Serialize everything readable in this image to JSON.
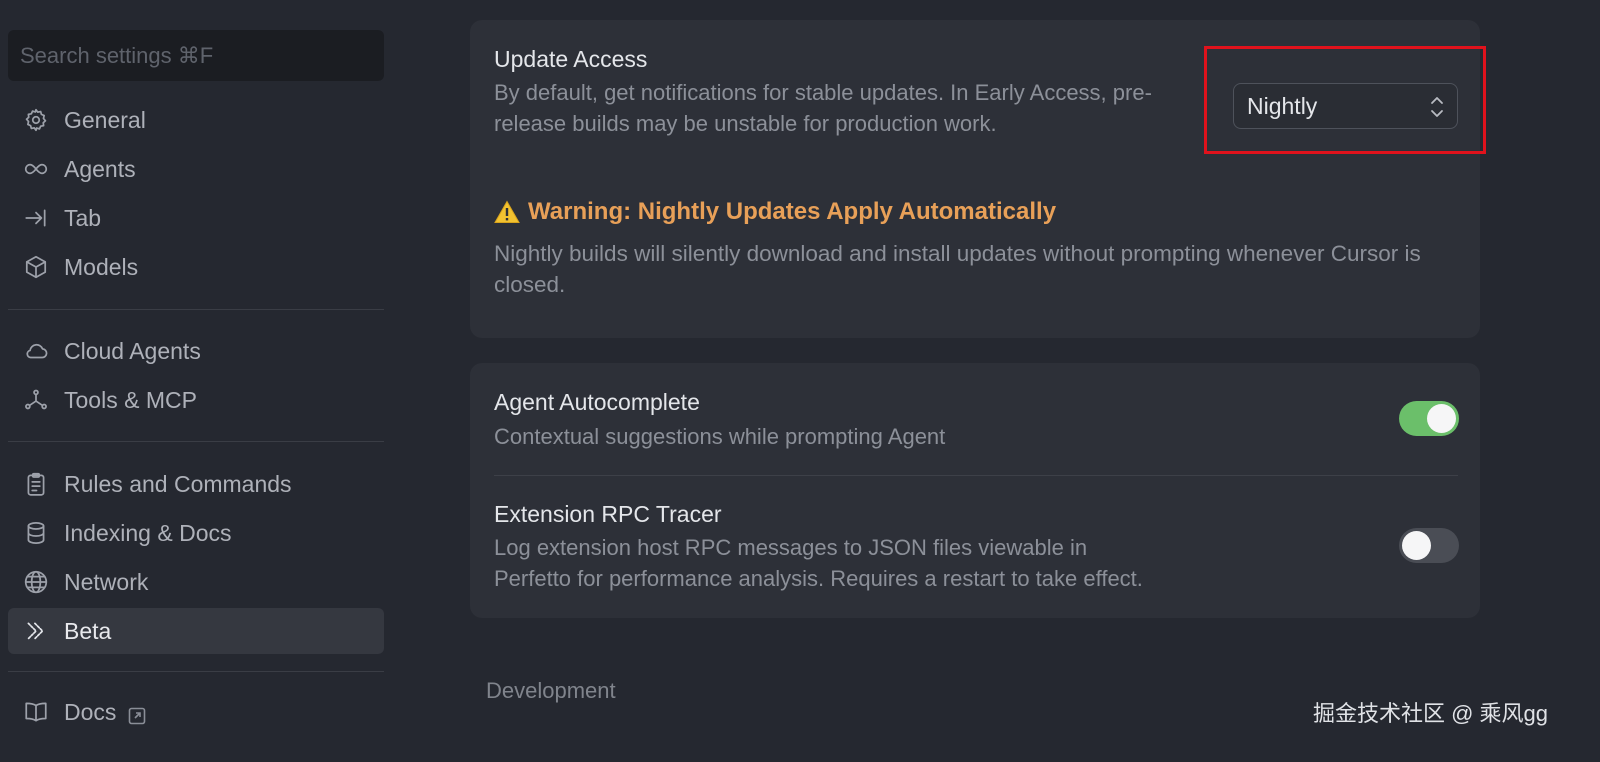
{
  "sidebar": {
    "search_placeholder": "Search settings ⌘F",
    "items": [
      {
        "label": "General",
        "icon": "gear-icon"
      },
      {
        "label": "Agents",
        "icon": "infinity-icon"
      },
      {
        "label": "Tab",
        "icon": "tab-arrow-icon"
      },
      {
        "label": "Models",
        "icon": "cube-icon"
      },
      {
        "label": "Cloud Agents",
        "icon": "cloud-icon"
      },
      {
        "label": "Tools & MCP",
        "icon": "nodes-icon"
      },
      {
        "label": "Rules and Commands",
        "icon": "clipboard-icon"
      },
      {
        "label": "Indexing & Docs",
        "icon": "database-icon"
      },
      {
        "label": "Network",
        "icon": "globe-icon"
      },
      {
        "label": "Beta",
        "icon": "chevrons-icon",
        "active": true
      },
      {
        "label": "Docs",
        "icon": "book-icon"
      }
    ]
  },
  "update_access": {
    "title": "Update Access",
    "description": "By default, get notifications for stable updates. In Early Access, pre-release builds may be unstable for production work.",
    "selected": "Nightly",
    "warning_title": "Warning: Nightly Updates Apply Automatically",
    "warning_body": "Nightly builds will silently download and install updates without prompting whenever Cursor is closed."
  },
  "agent_autocomplete": {
    "title": "Agent Autocomplete",
    "description": "Contextual suggestions while prompting Agent",
    "enabled": true
  },
  "rpc_tracer": {
    "title": "Extension RPC Tracer",
    "description": "Log extension host RPC messages to JSON files viewable in Perfetto for performance analysis. Requires a restart to take effect.",
    "enabled": false
  },
  "section_label": "Development",
  "watermark": "掘金技术社区 @ 乘风gg",
  "colors": {
    "accent_green": "#6bbf6a",
    "warning_orange": "#e8a058",
    "highlight_red": "#e0121c"
  }
}
